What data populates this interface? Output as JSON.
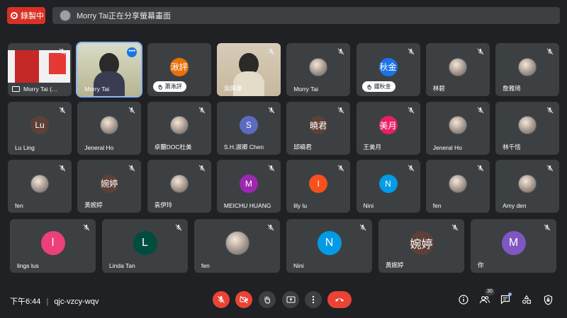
{
  "recording": {
    "label": "錄製中"
  },
  "share_banner": {
    "text": "Morry Tai正在分享螢幕畫面"
  },
  "tiles": [
    {
      "name": "Morry Tai (…",
      "kind": "screen",
      "muted": true
    },
    {
      "name": "Morry Tai",
      "kind": "video",
      "selected": true
    },
    {
      "name": "蕭湫評",
      "kind": "avatar",
      "initials": "湫評",
      "color": "#e8710a",
      "chip": true
    },
    {
      "name": "吳佩華",
      "kind": "video",
      "muted": true
    },
    {
      "name": "Morry Tai",
      "kind": "photo",
      "muted": true
    },
    {
      "name": "鍾秋金",
      "kind": "avatar",
      "initials": "秋金",
      "color": "#1a73e8",
      "chip": true,
      "muted": true
    },
    {
      "name": "林碧",
      "kind": "photo",
      "muted": true
    },
    {
      "name": "詹雅琦",
      "kind": "photo",
      "muted": true
    },
    {
      "name": "Lu Ling",
      "kind": "avatar",
      "initials": "Lu",
      "color": "#5d4037",
      "muted": true
    },
    {
      "name": "Jeneral Ho",
      "kind": "photo",
      "muted": true
    },
    {
      "name": "卓蘭DOC杜美",
      "kind": "photo",
      "muted": true
    },
    {
      "name": "S.H.淑卿 Chen",
      "kind": "avatar",
      "initials": "S",
      "color": "#5c6bc0",
      "muted": true
    },
    {
      "name": "邱曉君",
      "kind": "avatar",
      "initials": "曉君",
      "color": "#5d4037",
      "muted": true
    },
    {
      "name": "王美月",
      "kind": "avatar",
      "initials": "美月",
      "color": "#e91e63",
      "muted": true
    },
    {
      "name": "Jeneral Ho",
      "kind": "photo",
      "muted": true
    },
    {
      "name": "林千恬",
      "kind": "photo",
      "muted": true
    },
    {
      "name": "fen",
      "kind": "photo",
      "muted": true
    },
    {
      "name": "黃婉婷",
      "kind": "avatar",
      "initials": "婉婷",
      "color": "#5d4037",
      "muted": true
    },
    {
      "name": "袁伊玲",
      "kind": "photo",
      "muted": true
    },
    {
      "name": "MEICHU HUANG",
      "kind": "avatar",
      "initials": "M",
      "color": "#9c27b0",
      "muted": true
    },
    {
      "name": "lily lu",
      "kind": "avatar",
      "initials": "l",
      "color": "#f4511e",
      "muted": true
    },
    {
      "name": "Nini",
      "kind": "avatar",
      "initials": "N",
      "color": "#039be5",
      "muted": true
    },
    {
      "name": "fen",
      "kind": "photo",
      "muted": true
    },
    {
      "name": "Amy den",
      "kind": "photo",
      "muted": true
    },
    {
      "name": "lings lus",
      "kind": "avatar",
      "initials": "l",
      "color": "#ec407a",
      "muted": true
    },
    {
      "name": "Linda Tan",
      "kind": "avatar",
      "initials": "L",
      "color": "#004d40",
      "muted": true
    },
    {
      "name": "fen",
      "kind": "photo",
      "muted": true
    },
    {
      "name": "Nini",
      "kind": "avatar",
      "initials": "N",
      "color": "#039be5",
      "muted": true
    },
    {
      "name": "黃婉婷",
      "kind": "avatar",
      "initials": "婉婷",
      "color": "#5d4037",
      "muted": true
    },
    {
      "name": "你",
      "kind": "avatar",
      "initials": "M",
      "color": "#7e57c2",
      "muted": true
    }
  ],
  "bottom_bar": {
    "time": "下午6:44",
    "separator": "|",
    "meeting_code": "qjc-vzcy-wqv",
    "participant_count": "30"
  },
  "colors": {
    "background": "#202124",
    "tile": "#3c4043",
    "danger": "#ea4335",
    "accent": "#8ab4f8"
  }
}
